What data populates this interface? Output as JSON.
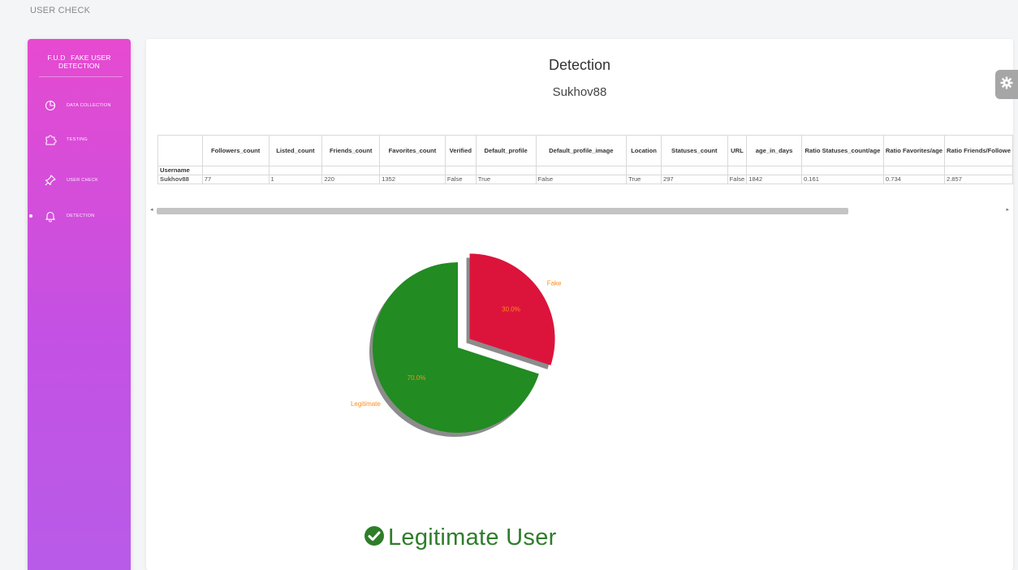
{
  "app": {
    "title": "USER CHECK"
  },
  "sidebar": {
    "brand_abbr": "F.U.D",
    "brand_name": "FAKE USER DETECTION",
    "items": [
      {
        "label": "DATA COLLECTION",
        "icon": "pie-chart-icon"
      },
      {
        "label": "TESTING",
        "icon": "puzzle-icon"
      },
      {
        "label": "USER CHECK",
        "icon": "pin-icon"
      },
      {
        "label": "DETECTION",
        "icon": "bell-icon",
        "active": true
      }
    ]
  },
  "detection": {
    "title": "Detection",
    "username": "Sukhov88"
  },
  "table": {
    "columns": [
      "Followers_count",
      "Listed_count",
      "Friends_count",
      "Favorites_count",
      "Verified",
      "Default_profile",
      "Default_profile_image",
      "Location",
      "Statuses_count",
      "URL",
      "age_in_days",
      "Ratio Statuses_count/age",
      "Ratio Favorites/age",
      "Ratio Friends/Followe"
    ],
    "index_name": "Username",
    "rows": [
      {
        "index": "Sukhov88",
        "values": [
          "77",
          "1",
          "220",
          "1352",
          "False",
          "True",
          "False",
          "True",
          "297",
          "False",
          "1842",
          "0.161",
          "0.734",
          "2.857"
        ]
      }
    ]
  },
  "chart_data": {
    "type": "pie",
    "categories": [
      "Fake",
      "Legitimate"
    ],
    "values": [
      30.0,
      70.0
    ],
    "labels": [
      "30.0%",
      "70.0%"
    ],
    "colors": [
      "#dc143c",
      "#228b22"
    ],
    "explode": "Fake",
    "shadow": true
  },
  "verdict": {
    "text": "Legitimate User",
    "icon": "check-circle-icon",
    "color": "#2f7d2a"
  },
  "colors": {
    "sidebar_top": "#e64ad0",
    "sidebar_bottom": "#b85be8",
    "label_text": "#ff8c1a"
  }
}
